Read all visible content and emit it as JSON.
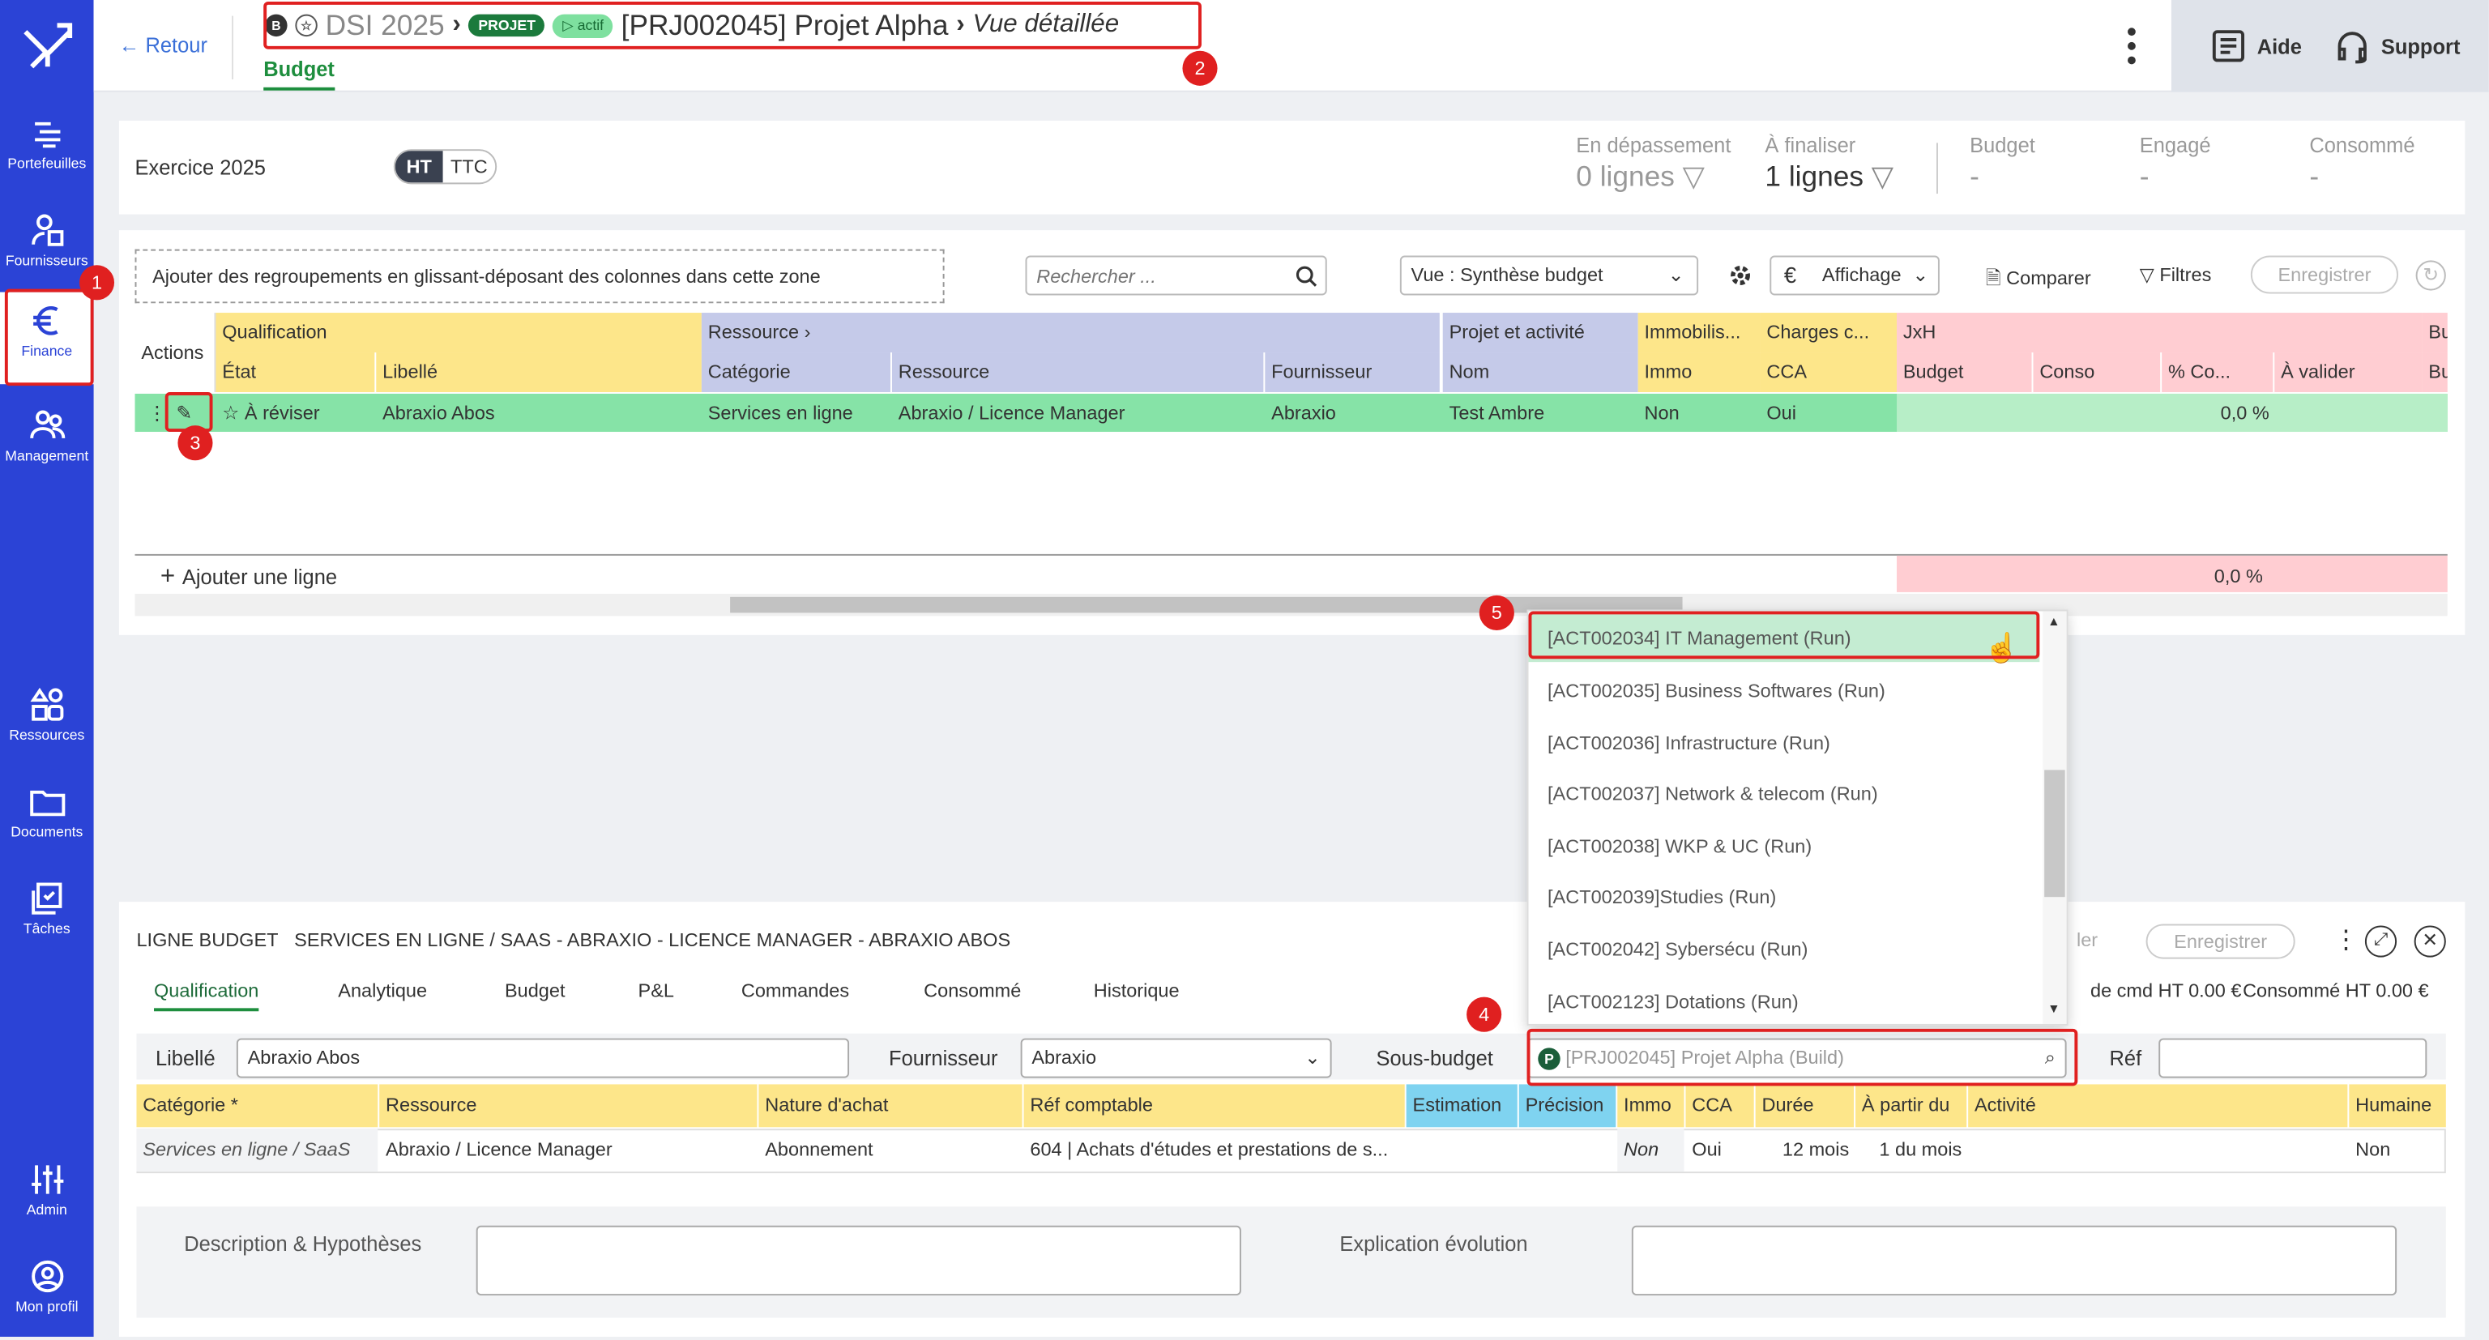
{
  "sidebar": {
    "items": [
      {
        "label": "Portefeuilles",
        "icon": "portfolio-icon"
      },
      {
        "label": "Fournisseurs",
        "icon": "suppliers-icon"
      },
      {
        "label": "Finance",
        "icon": "euro-icon"
      },
      {
        "label": "Management",
        "icon": "management-icon"
      },
      {
        "label": "Ressources",
        "icon": "resources-icon"
      },
      {
        "label": "Documents",
        "icon": "folder-icon"
      },
      {
        "label": "Tâches",
        "icon": "tasks-icon"
      },
      {
        "label": "Admin",
        "icon": "sliders-icon"
      },
      {
        "label": "Mon profil",
        "icon": "profile-icon"
      }
    ]
  },
  "header": {
    "back": "Retour",
    "b_badge": "B",
    "dsi": "DSI 2025",
    "proj_pill": "PROJET",
    "actif_pill": "▷ actif",
    "title": "[PRJ002045] Projet Alpha",
    "view": "Vue détaillée",
    "tab": "Budget",
    "help": "Aide",
    "support": "Support"
  },
  "annotations": {
    "n1": "1",
    "n2": "2",
    "n3": "3",
    "n4": "4",
    "n5": "5"
  },
  "summary": {
    "exercise": "Exercice 2025",
    "ht": "HT",
    "ttc": "TTC",
    "over_label": "En dépassement",
    "over_value": "0 lignes",
    "finalize_label": "À finaliser",
    "finalize_value": "1 lignes",
    "budget_label": "Budget",
    "budget_value": "-",
    "engage_label": "Engagé",
    "engage_value": "-",
    "consomme_label": "Consommé",
    "consomme_value": "-"
  },
  "toolbar": {
    "group_zone": "Ajouter des regroupements en glissant-déposant des colonnes dans cette zone",
    "search_placeholder": "Rechercher ...",
    "view_select": "Vue : Synthèse budget",
    "affichage": "Affichage",
    "compare": "Comparer",
    "filters": "Filtres",
    "save": "Enregistrer"
  },
  "grid": {
    "groups": {
      "actions": "Actions",
      "qualification": "Qualification",
      "ressource": "Ressource",
      "projet": "Projet et activité",
      "immo": "Immobilis...",
      "charges": "Charges c...",
      "jxh": "JxH",
      "bu": "Bu"
    },
    "columns": {
      "etat": "État",
      "libelle": "Libellé",
      "categorie": "Catégorie",
      "ressource": "Ressource",
      "fournisseur": "Fournisseur",
      "nom": "Nom",
      "immo": "Immo",
      "cca": "CCA",
      "budget": "Budget",
      "conso": "Conso",
      "pco": "% Co...",
      "avalider": "À valider",
      "bu": "Bu"
    },
    "row": {
      "etat": "À réviser",
      "libelle": "Abraxio Abos",
      "categorie": "Services en ligne",
      "ressource": "Abraxio / Licence Manager",
      "fournisseur": "Abraxio",
      "nom": "Test Ambre",
      "immo": "Non",
      "cca": "Oui",
      "pct": "0,0 %"
    },
    "add_line": "Ajouter une ligne",
    "total_pct": "0,0 %"
  },
  "dropdown": {
    "items": [
      "[ACT002034] IT Management (Run)",
      "[ACT002035] Business Softwares (Run)",
      "[ACT002036] Infrastructure (Run)",
      "[ACT002037] Network & telecom (Run)",
      "[ACT002038] WKP & UC (Run)",
      "[ACT002039]Studies (Run)",
      "[ACT002042] Sybersécu (Run)",
      "[ACT002123] Dotations (Run)"
    ]
  },
  "form": {
    "heading_label": "LIGNE BUDGET",
    "heading_value": "SERVICES EN LIGNE / SAAS - ABRAXIO - LICENCE MANAGER - ABRAXIO ABOS",
    "save": "Enregistrer",
    "cancel_partial": "ler",
    "tabs": [
      "Qualification",
      "Analytique",
      "Budget",
      "P&L",
      "Commandes",
      "Consommé",
      "Historique"
    ],
    "cmd_info": "de cmd HT 0.00 €",
    "conso_info": "Consommé HT 0.00 €",
    "libelle_label": "Libellé",
    "libelle_value": "Abraxio Abos",
    "fournisseur_label": "Fournisseur",
    "fournisseur_value": "Abraxio",
    "sousbudget_label": "Sous-budget",
    "sousbudget_badge": "P",
    "sousbudget_value": "[PRJ002045] Projet Alpha (Build)",
    "ref_label": "Réf",
    "cols": {
      "categorie": "Catégorie *",
      "ressource": "Ressource",
      "nature": "Nature d'achat",
      "refcompta": "Réf comptable",
      "estimation": "Estimation",
      "precision": "Précision",
      "immo": "Immo",
      "cca": "CCA",
      "duree": "Durée",
      "apartir": "À partir du",
      "activite": "Activité",
      "humaine": "Humaine"
    },
    "row": {
      "categorie": "Services en ligne / SaaS",
      "ressource": "Abraxio / Licence Manager",
      "nature": "Abonnement",
      "refcompta": "604 | Achats d'études et prestations de s...",
      "immo": "Non",
      "cca": "Oui",
      "duree": "12 mois",
      "apartir": "1 du mois",
      "humaine": "Non"
    },
    "desc_label": "Description & Hypothèses",
    "evo_label": "Explication évolution"
  },
  "colors": {
    "sidebar": "#2b43d6",
    "qualif": "#fde68a",
    "ressource": "#c5cae9",
    "immo": "#fde68a",
    "jxh": "#ffcdd2",
    "row": "#86e3a7",
    "green": "#1e8e3e",
    "red": "#e02020"
  }
}
